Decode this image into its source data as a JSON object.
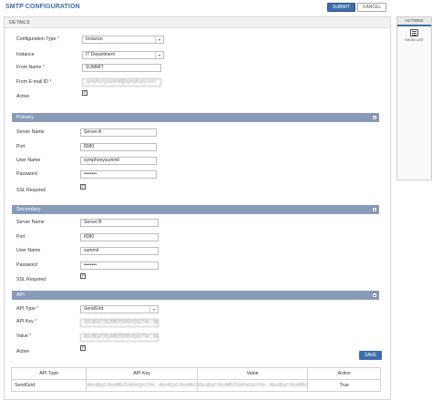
{
  "header": {
    "title": "SMTP CONFIGURATION",
    "submit_label": "SUBMIT",
    "cancel_label": "CANCEL"
  },
  "details": {
    "label": "DETAILS"
  },
  "actions": {
    "title": "ACTIONS",
    "show_list_label": "SHOW LIST",
    "show_list_icon": "list-icon"
  },
  "form": {
    "config_type": {
      "label": "Configuration Type",
      "value": "Instance"
    },
    "instance": {
      "label": "Instance",
      "value": "IT Department"
    },
    "from_name": {
      "label": "From Name",
      "value": "SUMMIT"
    },
    "from_email": {
      "label": "From E-mail ID",
      "value": "symphonysummit@symphony.com"
    },
    "active": {
      "label": "Active",
      "checked": true
    }
  },
  "primary": {
    "title": "Primary",
    "server_name": {
      "label": "Server Name",
      "value": "Server A"
    },
    "port": {
      "label": "Port",
      "value": "8080"
    },
    "user_name": {
      "label": "User Name",
      "value": "symphonysummit"
    },
    "password": {
      "label": "Password",
      "value": "••••••••"
    },
    "ssl": {
      "label": "SSL Required",
      "checked": true
    }
  },
  "secondary": {
    "title": "Secondary",
    "server_name": {
      "label": "Server Name",
      "value": "Server B"
    },
    "port": {
      "label": "Port",
      "value": "8080"
    },
    "user_name": {
      "label": "User Name",
      "value": "summit"
    },
    "password": {
      "label": "Password",
      "value": "••••••••"
    },
    "ssl": {
      "label": "SSL Required",
      "checked": true
    }
  },
  "api": {
    "title": "API",
    "api_type": {
      "label": "API Type",
      "value": "SendGrid"
    },
    "api_key": {
      "label": "API Key",
      "value": "AbcdEpCXkyMBZGHDxQsU7rkr...AbcdEpCXkyMBZ"
    },
    "value": {
      "label": "Value",
      "value": "AbcdEpCXkyMBZGHDxQsU7rkr...AbcdEpCXkyMBZ"
    },
    "active": {
      "label": "Active",
      "checked": true
    },
    "save_label": "SAVE"
  },
  "table": {
    "columns": [
      "API Type",
      "API Key",
      "Value",
      "Active"
    ],
    "rows": [
      [
        "SendGrid",
        "AbcdEpCXkyMBZGHDxQsU7rkr...AbcdEpCXkyMBZ",
        "AbcdEpCXkyMBZGHDxQsU7rkr...AbcdEpCXkyMBZ",
        "True"
      ]
    ]
  },
  "colors": {
    "accent": "#3e6ea9",
    "section_bar": "#8a9bb9",
    "required": "#c0392b"
  }
}
